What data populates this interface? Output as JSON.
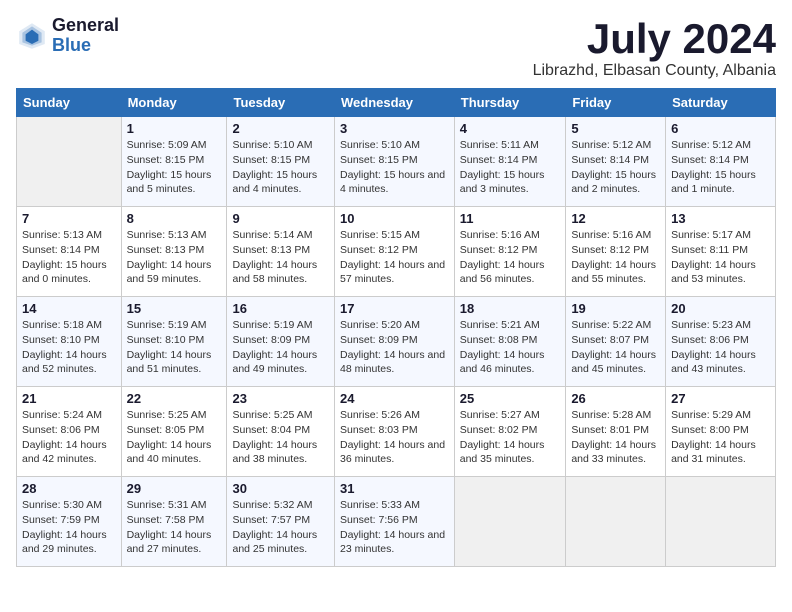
{
  "logo": {
    "general": "General",
    "blue": "Blue"
  },
  "title": "July 2024",
  "subtitle": "Librazhd, Elbasan County, Albania",
  "weekdays": [
    "Sunday",
    "Monday",
    "Tuesday",
    "Wednesday",
    "Thursday",
    "Friday",
    "Saturday"
  ],
  "weeks": [
    [
      {
        "day": "",
        "sunrise": "",
        "sunset": "",
        "daylight": ""
      },
      {
        "day": "1",
        "sunrise": "Sunrise: 5:09 AM",
        "sunset": "Sunset: 8:15 PM",
        "daylight": "Daylight: 15 hours and 5 minutes."
      },
      {
        "day": "2",
        "sunrise": "Sunrise: 5:10 AM",
        "sunset": "Sunset: 8:15 PM",
        "daylight": "Daylight: 15 hours and 4 minutes."
      },
      {
        "day": "3",
        "sunrise": "Sunrise: 5:10 AM",
        "sunset": "Sunset: 8:15 PM",
        "daylight": "Daylight: 15 hours and 4 minutes."
      },
      {
        "day": "4",
        "sunrise": "Sunrise: 5:11 AM",
        "sunset": "Sunset: 8:14 PM",
        "daylight": "Daylight: 15 hours and 3 minutes."
      },
      {
        "day": "5",
        "sunrise": "Sunrise: 5:12 AM",
        "sunset": "Sunset: 8:14 PM",
        "daylight": "Daylight: 15 hours and 2 minutes."
      },
      {
        "day": "6",
        "sunrise": "Sunrise: 5:12 AM",
        "sunset": "Sunset: 8:14 PM",
        "daylight": "Daylight: 15 hours and 1 minute."
      }
    ],
    [
      {
        "day": "7",
        "sunrise": "Sunrise: 5:13 AM",
        "sunset": "Sunset: 8:14 PM",
        "daylight": "Daylight: 15 hours and 0 minutes."
      },
      {
        "day": "8",
        "sunrise": "Sunrise: 5:13 AM",
        "sunset": "Sunset: 8:13 PM",
        "daylight": "Daylight: 14 hours and 59 minutes."
      },
      {
        "day": "9",
        "sunrise": "Sunrise: 5:14 AM",
        "sunset": "Sunset: 8:13 PM",
        "daylight": "Daylight: 14 hours and 58 minutes."
      },
      {
        "day": "10",
        "sunrise": "Sunrise: 5:15 AM",
        "sunset": "Sunset: 8:12 PM",
        "daylight": "Daylight: 14 hours and 57 minutes."
      },
      {
        "day": "11",
        "sunrise": "Sunrise: 5:16 AM",
        "sunset": "Sunset: 8:12 PM",
        "daylight": "Daylight: 14 hours and 56 minutes."
      },
      {
        "day": "12",
        "sunrise": "Sunrise: 5:16 AM",
        "sunset": "Sunset: 8:12 PM",
        "daylight": "Daylight: 14 hours and 55 minutes."
      },
      {
        "day": "13",
        "sunrise": "Sunrise: 5:17 AM",
        "sunset": "Sunset: 8:11 PM",
        "daylight": "Daylight: 14 hours and 53 minutes."
      }
    ],
    [
      {
        "day": "14",
        "sunrise": "Sunrise: 5:18 AM",
        "sunset": "Sunset: 8:10 PM",
        "daylight": "Daylight: 14 hours and 52 minutes."
      },
      {
        "day": "15",
        "sunrise": "Sunrise: 5:19 AM",
        "sunset": "Sunset: 8:10 PM",
        "daylight": "Daylight: 14 hours and 51 minutes."
      },
      {
        "day": "16",
        "sunrise": "Sunrise: 5:19 AM",
        "sunset": "Sunset: 8:09 PM",
        "daylight": "Daylight: 14 hours and 49 minutes."
      },
      {
        "day": "17",
        "sunrise": "Sunrise: 5:20 AM",
        "sunset": "Sunset: 8:09 PM",
        "daylight": "Daylight: 14 hours and 48 minutes."
      },
      {
        "day": "18",
        "sunrise": "Sunrise: 5:21 AM",
        "sunset": "Sunset: 8:08 PM",
        "daylight": "Daylight: 14 hours and 46 minutes."
      },
      {
        "day": "19",
        "sunrise": "Sunrise: 5:22 AM",
        "sunset": "Sunset: 8:07 PM",
        "daylight": "Daylight: 14 hours and 45 minutes."
      },
      {
        "day": "20",
        "sunrise": "Sunrise: 5:23 AM",
        "sunset": "Sunset: 8:06 PM",
        "daylight": "Daylight: 14 hours and 43 minutes."
      }
    ],
    [
      {
        "day": "21",
        "sunrise": "Sunrise: 5:24 AM",
        "sunset": "Sunset: 8:06 PM",
        "daylight": "Daylight: 14 hours and 42 minutes."
      },
      {
        "day": "22",
        "sunrise": "Sunrise: 5:25 AM",
        "sunset": "Sunset: 8:05 PM",
        "daylight": "Daylight: 14 hours and 40 minutes."
      },
      {
        "day": "23",
        "sunrise": "Sunrise: 5:25 AM",
        "sunset": "Sunset: 8:04 PM",
        "daylight": "Daylight: 14 hours and 38 minutes."
      },
      {
        "day": "24",
        "sunrise": "Sunrise: 5:26 AM",
        "sunset": "Sunset: 8:03 PM",
        "daylight": "Daylight: 14 hours and 36 minutes."
      },
      {
        "day": "25",
        "sunrise": "Sunrise: 5:27 AM",
        "sunset": "Sunset: 8:02 PM",
        "daylight": "Daylight: 14 hours and 35 minutes."
      },
      {
        "day": "26",
        "sunrise": "Sunrise: 5:28 AM",
        "sunset": "Sunset: 8:01 PM",
        "daylight": "Daylight: 14 hours and 33 minutes."
      },
      {
        "day": "27",
        "sunrise": "Sunrise: 5:29 AM",
        "sunset": "Sunset: 8:00 PM",
        "daylight": "Daylight: 14 hours and 31 minutes."
      }
    ],
    [
      {
        "day": "28",
        "sunrise": "Sunrise: 5:30 AM",
        "sunset": "Sunset: 7:59 PM",
        "daylight": "Daylight: 14 hours and 29 minutes."
      },
      {
        "day": "29",
        "sunrise": "Sunrise: 5:31 AM",
        "sunset": "Sunset: 7:58 PM",
        "daylight": "Daylight: 14 hours and 27 minutes."
      },
      {
        "day": "30",
        "sunrise": "Sunrise: 5:32 AM",
        "sunset": "Sunset: 7:57 PM",
        "daylight": "Daylight: 14 hours and 25 minutes."
      },
      {
        "day": "31",
        "sunrise": "Sunrise: 5:33 AM",
        "sunset": "Sunset: 7:56 PM",
        "daylight": "Daylight: 14 hours and 23 minutes."
      },
      {
        "day": "",
        "sunrise": "",
        "sunset": "",
        "daylight": ""
      },
      {
        "day": "",
        "sunrise": "",
        "sunset": "",
        "daylight": ""
      },
      {
        "day": "",
        "sunrise": "",
        "sunset": "",
        "daylight": ""
      }
    ]
  ]
}
